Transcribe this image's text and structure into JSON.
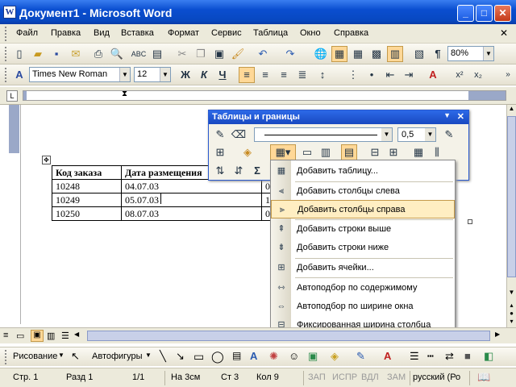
{
  "window": {
    "title": "Документ1 - Microsoft Word",
    "icon": "word-icon"
  },
  "menubar": [
    "Файл",
    "Правка",
    "Вид",
    "Вставка",
    "Формат",
    "Сервис",
    "Таблица",
    "Окно",
    "Справка"
  ],
  "standard_toolbar": {
    "zoom": "80%"
  },
  "formatting_toolbar": {
    "style_icon": "styles-icon",
    "font": "Times New Roman",
    "size": "12",
    "bold": "Ж",
    "italic": "К",
    "underline": "Ч"
  },
  "table": {
    "headers": [
      "Код заказа",
      "Дата размещения"
    ],
    "rows": [
      [
        "10248",
        "04.07.03",
        "0"
      ],
      [
        "10249",
        "05.07.03",
        "1"
      ],
      [
        "10250",
        "08.07.03",
        "0"
      ]
    ]
  },
  "tables_toolbar": {
    "title": "Таблицы и границы",
    "line_weight": "0,5"
  },
  "dropdown": {
    "items": [
      "Добавить таблицу...",
      "Добавить столбцы слева",
      "Добавить столбцы справа",
      "Добавить строки выше",
      "Добавить строки ниже",
      "Добавить ячейки...",
      "Автоподбор по содержимому",
      "Автоподбор по ширине окна",
      "Фиксированная ширина столбца"
    ],
    "highlighted": "Добавить столбцы справа"
  },
  "drawing_toolbar": {
    "draw": "Рисование",
    "autoshapes": "Автофигуры"
  },
  "status": {
    "page": "Стр. 1",
    "section": "Разд 1",
    "pages": "1/1",
    "at": "На 3см",
    "line": "Ст 3",
    "col": "Кол 9",
    "rec": "ЗАП",
    "trk": "ИСПР",
    "ext": "ВДЛ",
    "ovr": "ЗАМ",
    "lang": "русский (Ро"
  }
}
